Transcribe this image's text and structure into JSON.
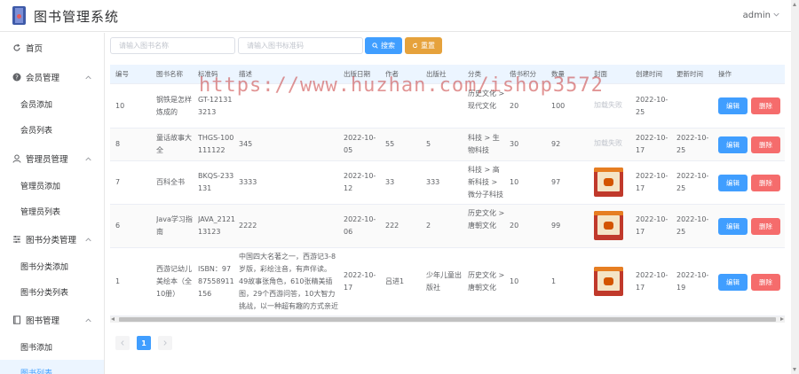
{
  "app": {
    "title": "图书管理系统",
    "user": "admin"
  },
  "sidebar": {
    "home": "首页",
    "groups": [
      {
        "label": "会员管理",
        "items": [
          "会员添加",
          "会员列表"
        ]
      },
      {
        "label": "管理员管理",
        "items": [
          "管理员添加",
          "管理员列表"
        ]
      },
      {
        "label": "图书分类管理",
        "items": [
          "图书分类添加",
          "图书分类列表"
        ]
      },
      {
        "label": "图书管理",
        "items": [
          "图书添加",
          "图书列表"
        ]
      }
    ]
  },
  "search": {
    "name_placeholder": "请输入图书名称",
    "code_placeholder": "请输入图书标准码",
    "search_label": "搜索",
    "reset_label": "重置"
  },
  "table": {
    "headers": [
      "编号",
      "图书名称",
      "标准码",
      "描述",
      "出版日期",
      "作者",
      "出版社",
      "分类",
      "借书积分",
      "数量",
      "封面",
      "创建时间",
      "更新时间",
      "操作"
    ],
    "edit_label": "编辑",
    "delete_label": "删除",
    "cover_fail_text": "加载失败",
    "rows": [
      {
        "id": "10",
        "name": "钢铁是怎样炼成的",
        "code": "GT-121313213",
        "desc": "",
        "pub_date": "",
        "author": "",
        "publisher": "",
        "category": "历史文化 > 现代文化",
        "points": "20",
        "qty": "100",
        "cover": "fail",
        "created": "2022-10-25",
        "updated": ""
      },
      {
        "id": "8",
        "name": "童话故事大全",
        "code": "THGS-100111122",
        "desc": "345",
        "pub_date": "2022-10-05",
        "author": "55",
        "publisher": "5",
        "category": "科技 > 生物科技",
        "points": "30",
        "qty": "92",
        "cover": "fail",
        "created": "2022-10-17",
        "updated": "2022-10-25"
      },
      {
        "id": "7",
        "name": "百科全书",
        "code": "BKQS-233131",
        "desc": "3333",
        "pub_date": "2022-10-12",
        "author": "33",
        "publisher": "333",
        "category": "科技 > 高新科技 > 微分子科技",
        "points": "10",
        "qty": "97",
        "cover": "img",
        "created": "2022-10-17",
        "updated": "2022-10-25"
      },
      {
        "id": "6",
        "name": "Java学习指南",
        "code": "JAVA_212113123",
        "desc": "2222",
        "pub_date": "2022-10-06",
        "author": "222",
        "publisher": "2",
        "category": "历史文化 > 唐朝文化",
        "points": "20",
        "qty": "99",
        "cover": "img",
        "created": "2022-10-17",
        "updated": "2022-10-25"
      },
      {
        "id": "1",
        "name": "西游记幼儿美绘本（全10册）",
        "code": "ISBN：9787558911156",
        "desc": "中国四大名著之一，西游记3-8岁版，彩绘注音，有声伴读。49故事张角色，610张精美插图，29个西游问答，10大智力挑战，以一种超有趣的方式亲近名著经典。",
        "pub_date": "2022-10-17",
        "author": "吕进1",
        "publisher": "少年儿童出版社",
        "category": "历史文化 > 唐朝文化",
        "points": "10",
        "qty": "1",
        "cover": "img",
        "created": "2022-10-17",
        "updated": "2022-10-19"
      }
    ]
  },
  "pagination": {
    "current": "1"
  },
  "watermark": "https://www.huzhan.com/ishop3572"
}
